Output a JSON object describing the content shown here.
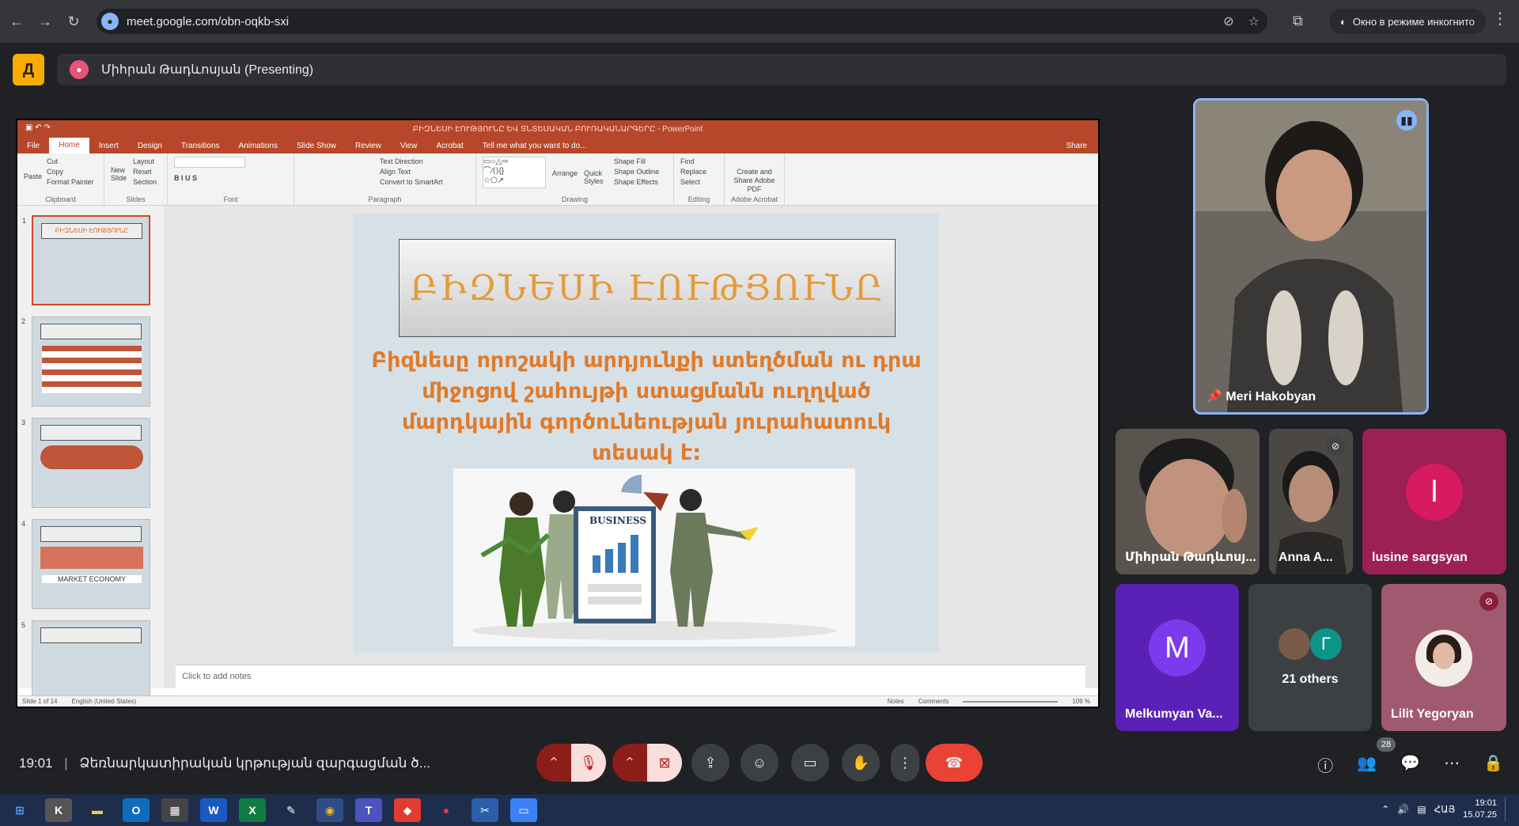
{
  "browser": {
    "url": "meet.google.com/obn-oqkb-sxi",
    "incognito_label": "Окно в режиме инкогнито"
  },
  "meet": {
    "presenter_label": "Միհրան Թադևոսյան (Presenting)",
    "time": "19:01",
    "meeting_title": "Ձեռնարկատիրական կրթության զարգացման ծ...",
    "participant_count": "28"
  },
  "powerpoint": {
    "window_title": "ԲԻԶՆԵՍԻ ԷՈՒԹՅՈՒՆԸ ԵՎ ՏՆՏԵՍԱԿԱՆ ԲՈՒՌԱԿԱՆԱՐԳԵՐԸ - PowerPoint",
    "tabs": [
      "File",
      "Home",
      "Insert",
      "Design",
      "Transitions",
      "Animations",
      "Slide Show",
      "Review",
      "View",
      "Acrobat",
      "Tell me what you want to do..."
    ],
    "share_label": "Share",
    "ribbon_groups": [
      "Clipboard",
      "Slides",
      "Font",
      "Paragraph",
      "Drawing",
      "Editing",
      "Adobe Acrobat"
    ],
    "ribbon_items": {
      "paste": "Paste",
      "cut": "Cut",
      "copy": "Copy",
      "format_painter": "Format Painter",
      "new_slide": "New Slide",
      "layout": "Layout",
      "reset": "Reset",
      "section": "Section",
      "text_direction": "Text Direction",
      "align_text": "Align Text",
      "convert_smartart": "Convert to SmartArt",
      "arrange": "Arrange",
      "quick_styles": "Quick Styles",
      "shape_fill": "Shape Fill",
      "shape_outline": "Shape Outline",
      "shape_effects": "Shape Effects",
      "find": "Find",
      "replace": "Replace",
      "select": "Select",
      "create_share_pdf": "Create and Share Adobe PDF"
    },
    "slide_numbers": [
      "1",
      "2",
      "3",
      "4",
      "5"
    ],
    "thumb_label_market": "MARKET ECONOMY",
    "slide_title": "ԲԻԶՆԵՍԻ ԷՈՒԹՅՈՒՆԸ",
    "slide_body": "Բիզնեսը որոշակի արդյունքի ստեղծման ու դրա միջոցով շահույթի ստացմանն ուղղված մարդկային գործունեության յուրահատուկ տեսակ է:",
    "slide_image_text": "BUSINESS",
    "notes_placeholder": "Click to add notes",
    "status_slide": "Slide 1 of 14",
    "status_lang": "English (United States)",
    "status_notes": "Notes",
    "status_comments": "Comments",
    "status_zoom": "109 %"
  },
  "participants": [
    {
      "name": "Meri Hakobyan"
    },
    {
      "name": "Միհրան Թադևոսյ..."
    },
    {
      "name": "Anna A..."
    },
    {
      "name": "lusine sargsyan",
      "initial": "l"
    },
    {
      "name": "Melkumyan Va...",
      "initial": "M"
    },
    {
      "name": "21 others",
      "initial": "Г"
    },
    {
      "name": "Lilit Yegoryan"
    }
  ],
  "taskbar": {
    "lang": "ՀԱՅ",
    "clock_time": "19:01",
    "clock_date": "15.07.25"
  },
  "colors": {
    "meet_bg": "#202124",
    "ppt_accent": "#b7472a",
    "hangup_red": "#ea4335",
    "speaking_blue": "#8ab4f8",
    "lusine_tile": "#9c1f55",
    "melkumyan_tile": "#5b21b6"
  }
}
